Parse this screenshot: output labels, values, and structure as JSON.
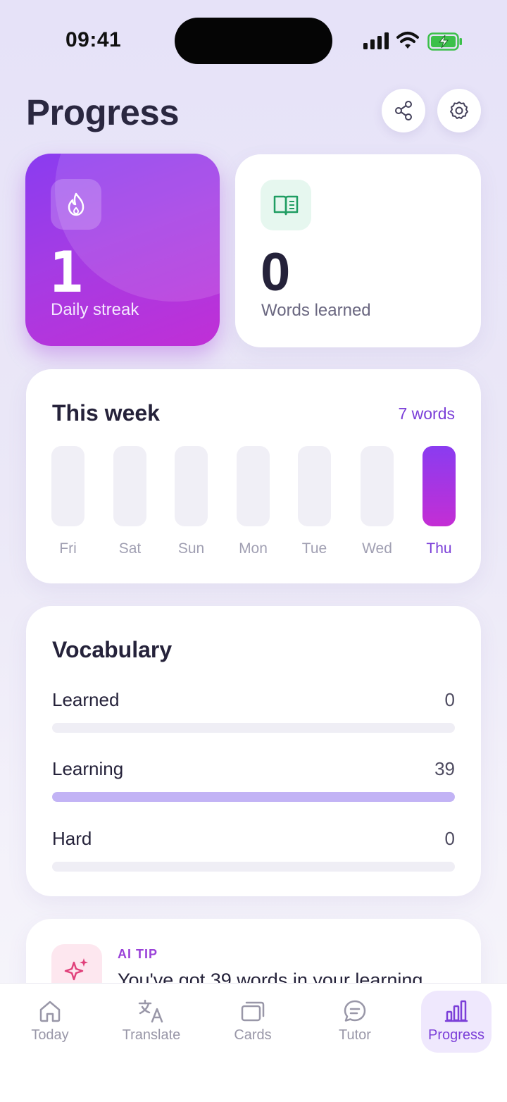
{
  "status_bar": {
    "time": "09:41"
  },
  "header": {
    "title": "Progress"
  },
  "stats": {
    "streak": {
      "value": "1",
      "label": "Daily streak",
      "icon": "flame-icon"
    },
    "words": {
      "value": "0",
      "label": "Words learned",
      "icon": "open-book-icon"
    }
  },
  "week": {
    "title": "This week",
    "total": "7 words",
    "days": [
      {
        "label": "Fri",
        "active": false
      },
      {
        "label": "Sat",
        "active": false
      },
      {
        "label": "Sun",
        "active": false
      },
      {
        "label": "Mon",
        "active": false
      },
      {
        "label": "Tue",
        "active": false
      },
      {
        "label": "Wed",
        "active": false
      },
      {
        "label": "Thu",
        "active": true
      }
    ]
  },
  "vocabulary": {
    "title": "Vocabulary",
    "rows": [
      {
        "name": "Learned",
        "count": "0",
        "fill": 0
      },
      {
        "name": "Learning",
        "count": "39",
        "fill": 1
      },
      {
        "name": "Hard",
        "count": "0",
        "fill": 0
      }
    ]
  },
  "tip": {
    "label": "AI TIP",
    "text": "You've got 39 words in your learning",
    "icon": "sparkle-icon"
  },
  "tabs": [
    {
      "label": "Today",
      "icon": "home-icon",
      "active": false
    },
    {
      "label": "Translate",
      "icon": "translate-icon",
      "active": false
    },
    {
      "label": "Cards",
      "icon": "cards-icon",
      "active": false
    },
    {
      "label": "Tutor",
      "icon": "chat-icon",
      "active": false
    },
    {
      "label": "Progress",
      "icon": "bar-chart-icon",
      "active": true
    }
  ],
  "colors": {
    "accent": "#7b3fd8",
    "streak_gradient_start": "#8a3cf0",
    "streak_gradient_end": "#c02fd6",
    "learning_fill": "#c2b3f5"
  }
}
